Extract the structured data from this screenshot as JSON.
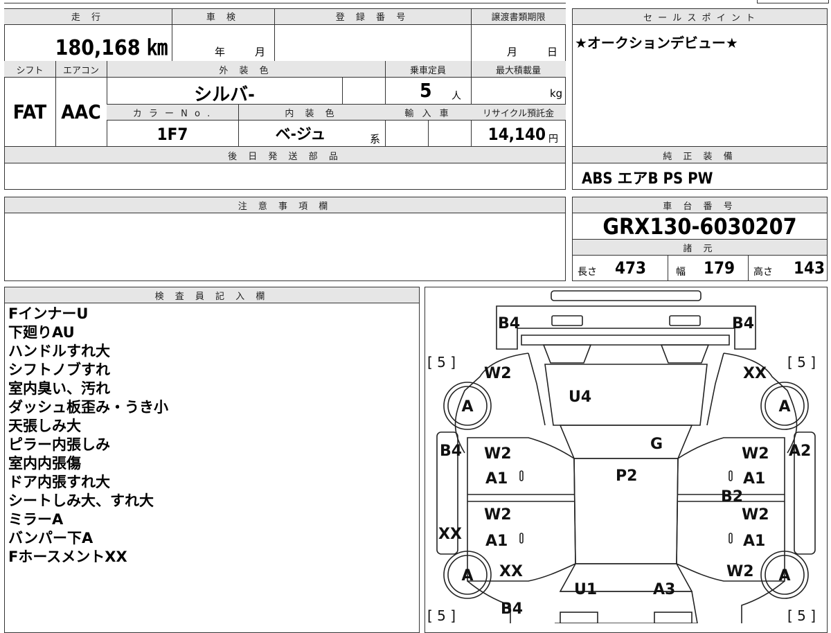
{
  "header": {
    "mileage_label": "走 行",
    "shaken_label": "車 検",
    "registration_label": "登 録 番 号",
    "transfer_deadline_label": "譲渡書類期限",
    "sales_point_label": "セ ー ル ス ポ イ ン ト"
  },
  "mileage": "180,168 ㎞",
  "shaken": {
    "year_unit": "年",
    "month_unit": "月"
  },
  "transfer": {
    "month_unit": "月",
    "day_unit": "日"
  },
  "sales_point": "★オークションデビュー★",
  "row2_labels": {
    "shift": "シフト",
    "aircon": "エアコン",
    "exterior_color": "外 装 色",
    "capacity": "乗車定員",
    "max_load": "最大積載量"
  },
  "shift": "FAT",
  "aircon": "AAC",
  "exterior_color": "シルバ-",
  "capacity": "5",
  "capacity_unit": "人",
  "max_load_unit": "kg",
  "row3_labels": {
    "color_no": "カ ラ ー N o .",
    "interior_color": "内 装 色",
    "import": "輸 入 車",
    "recycle": "リサイクル預託金"
  },
  "color_no": "1F7",
  "interior_color": "ベ-ジュ",
  "interior_suffix": "系",
  "recycle_fee": "14,140",
  "recycle_unit": "円",
  "later_parts_label": "後 日 発 送 部 品",
  "equipment_label": "純 正 装 備",
  "equipment": "ABS エアB PS PW",
  "caution_label": "注 意 事 項 欄",
  "chassis_label": "車 台 番 号",
  "chassis_number": "GRX130-6030207",
  "specs_label": "諸 元",
  "specs": {
    "length_label": "長さ",
    "length": "473",
    "width_label": "幅",
    "width": "179",
    "height_label": "高さ",
    "height": "143"
  },
  "inspector_label": "検 査 員 記 入 欄",
  "inspector_notes": [
    "FインナーU",
    "下廻りAU",
    "ハンドルすれ大",
    "シフトノブすれ",
    "室内臭い、汚れ",
    "ダッシュ板歪み・うき小",
    "天張しみ大",
    "ピラー内張しみ",
    "室内内張傷",
    "ドア内張すれ大",
    "シートしみ大、すれ大",
    "ミラーA",
    "バンパー下A",
    "FホースメントXX"
  ],
  "diagram_marks": {
    "b4_tl": "B4",
    "b4_tr": "B4",
    "w2_front_left": "W2",
    "xx_front_right": "XX",
    "u4_hood": "U4",
    "g_windshield": "G",
    "b4_left": "B4",
    "a2_right": "A2",
    "w2_fl_door": "W2",
    "a1_fl_door": "A1",
    "p2_roof": "P2",
    "w2_fr_door": "W2",
    "a1_fr_door": "A1",
    "b2_pillar": "B2",
    "w2_rl_door": "W2",
    "a1_rl_door": "A1",
    "w2_rr_door": "W2",
    "a1_rr_door": "A1",
    "xx_left": "XX",
    "xx_rear_left": "XX",
    "w2_rear_right": "W2",
    "u1_trunk": "U1",
    "a3_trunk": "A3",
    "b4_rear": "B4",
    "tire_a": "A",
    "tire_5": "[ 5 ]",
    "zero": "0"
  }
}
